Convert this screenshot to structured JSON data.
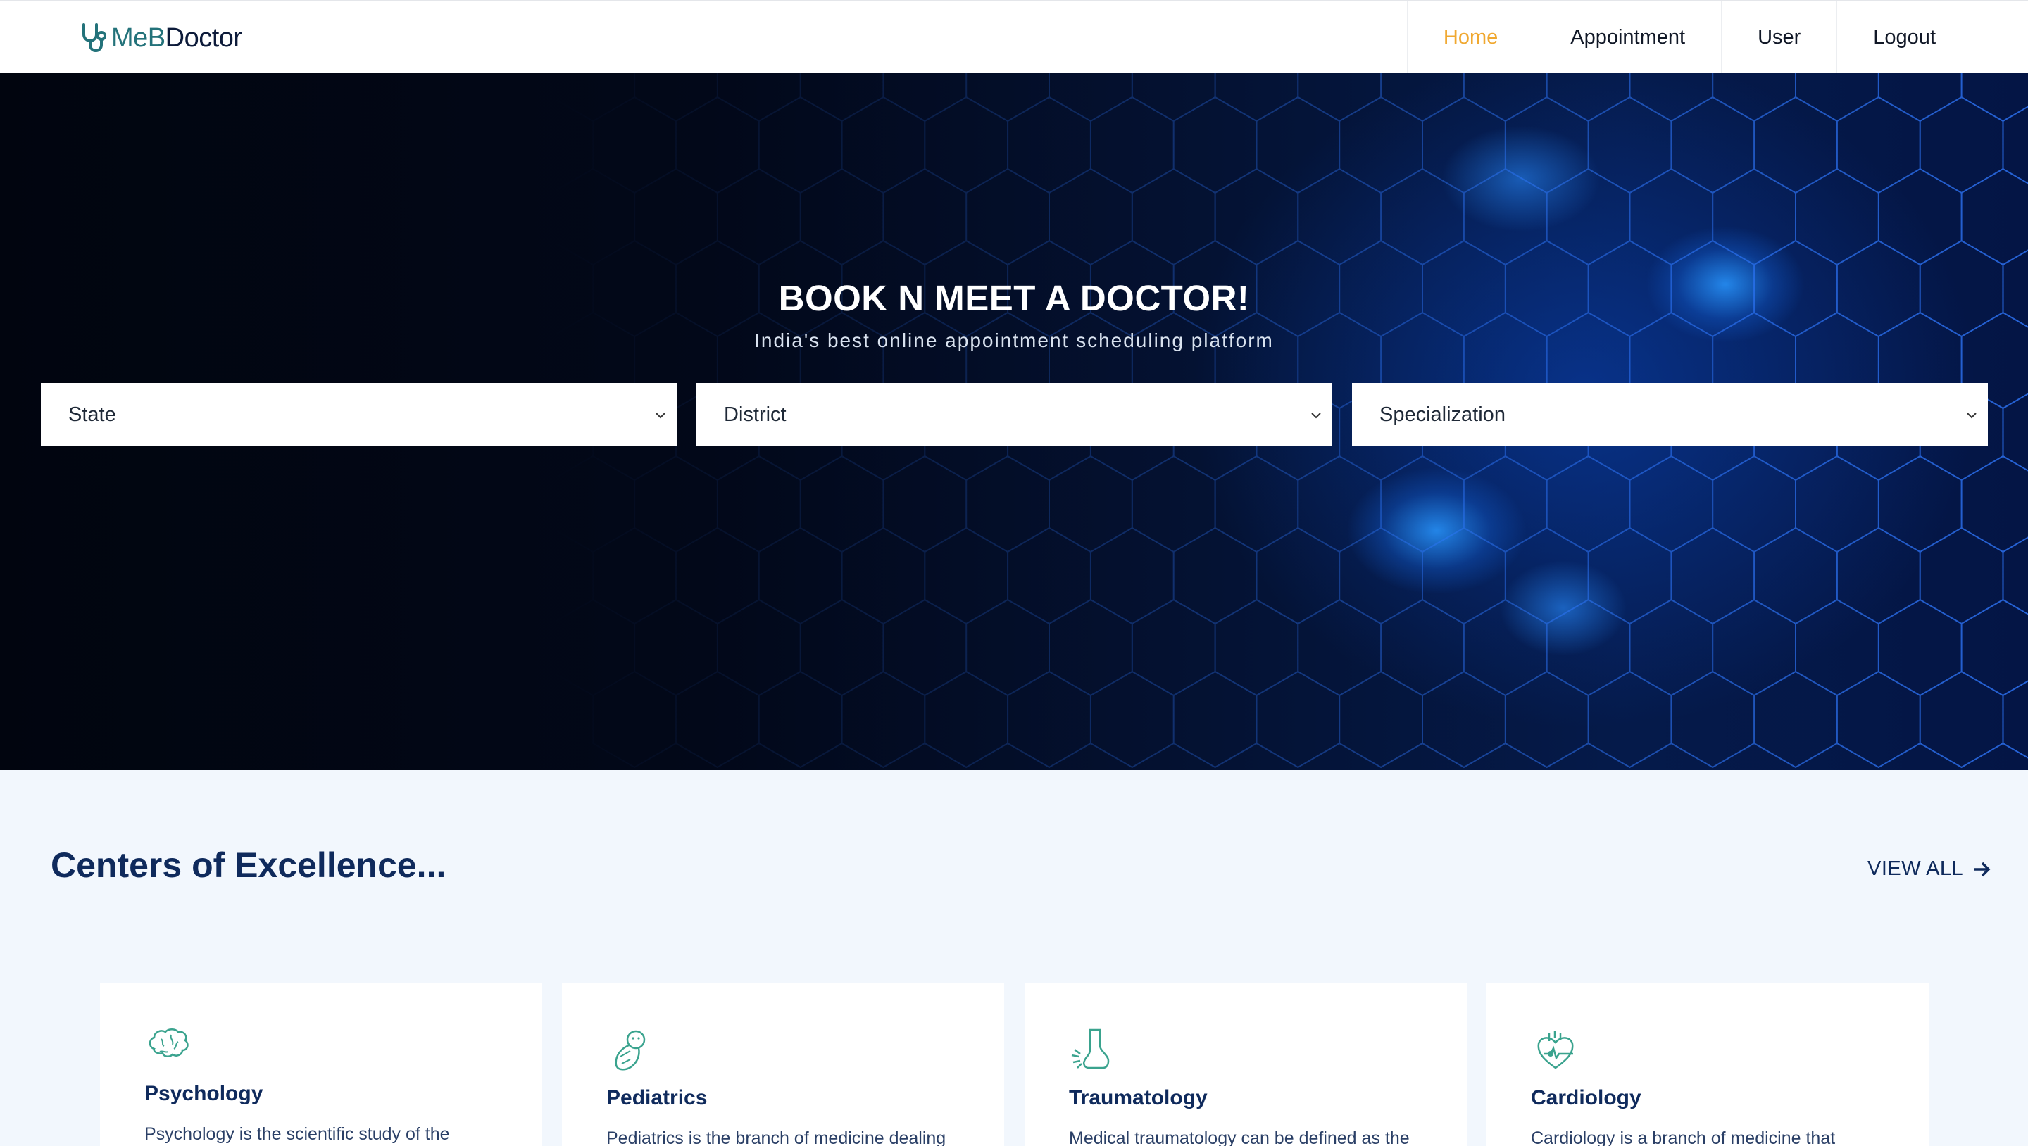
{
  "brand": {
    "part1": "MeB",
    "part2": "Doctor"
  },
  "nav": [
    {
      "label": "Home",
      "active": true
    },
    {
      "label": "Appointment",
      "active": false
    },
    {
      "label": "User",
      "active": false
    },
    {
      "label": "Logout",
      "active": false
    }
  ],
  "hero": {
    "title": "BOOK N MEET A DOCTOR!",
    "subtitle": "India's best online appointment scheduling platform",
    "selects": [
      {
        "selected": "State"
      },
      {
        "selected": "District"
      },
      {
        "selected": "Specialization"
      }
    ]
  },
  "centers": {
    "title": "Centers of Excellence...",
    "view_all": "VIEW ALL",
    "cards": [
      {
        "title": "Psychology",
        "desc": "Psychology is the scientific study of the",
        "icon": "brain-icon"
      },
      {
        "title": "Pediatrics",
        "desc": "Pediatrics is the branch of medicine dealing",
        "icon": "baby-icon"
      },
      {
        "title": "Traumatology",
        "desc": "Medical traumatology can be defined as the",
        "icon": "injured-foot-icon"
      },
      {
        "title": "Cardiology",
        "desc": "Cardiology is a branch of medicine that",
        "icon": "heart-icon"
      }
    ]
  },
  "colors": {
    "accent": "#f0a830",
    "brand": "#23727a",
    "navy": "#0f2a5c",
    "icon": "#3aa38e"
  }
}
